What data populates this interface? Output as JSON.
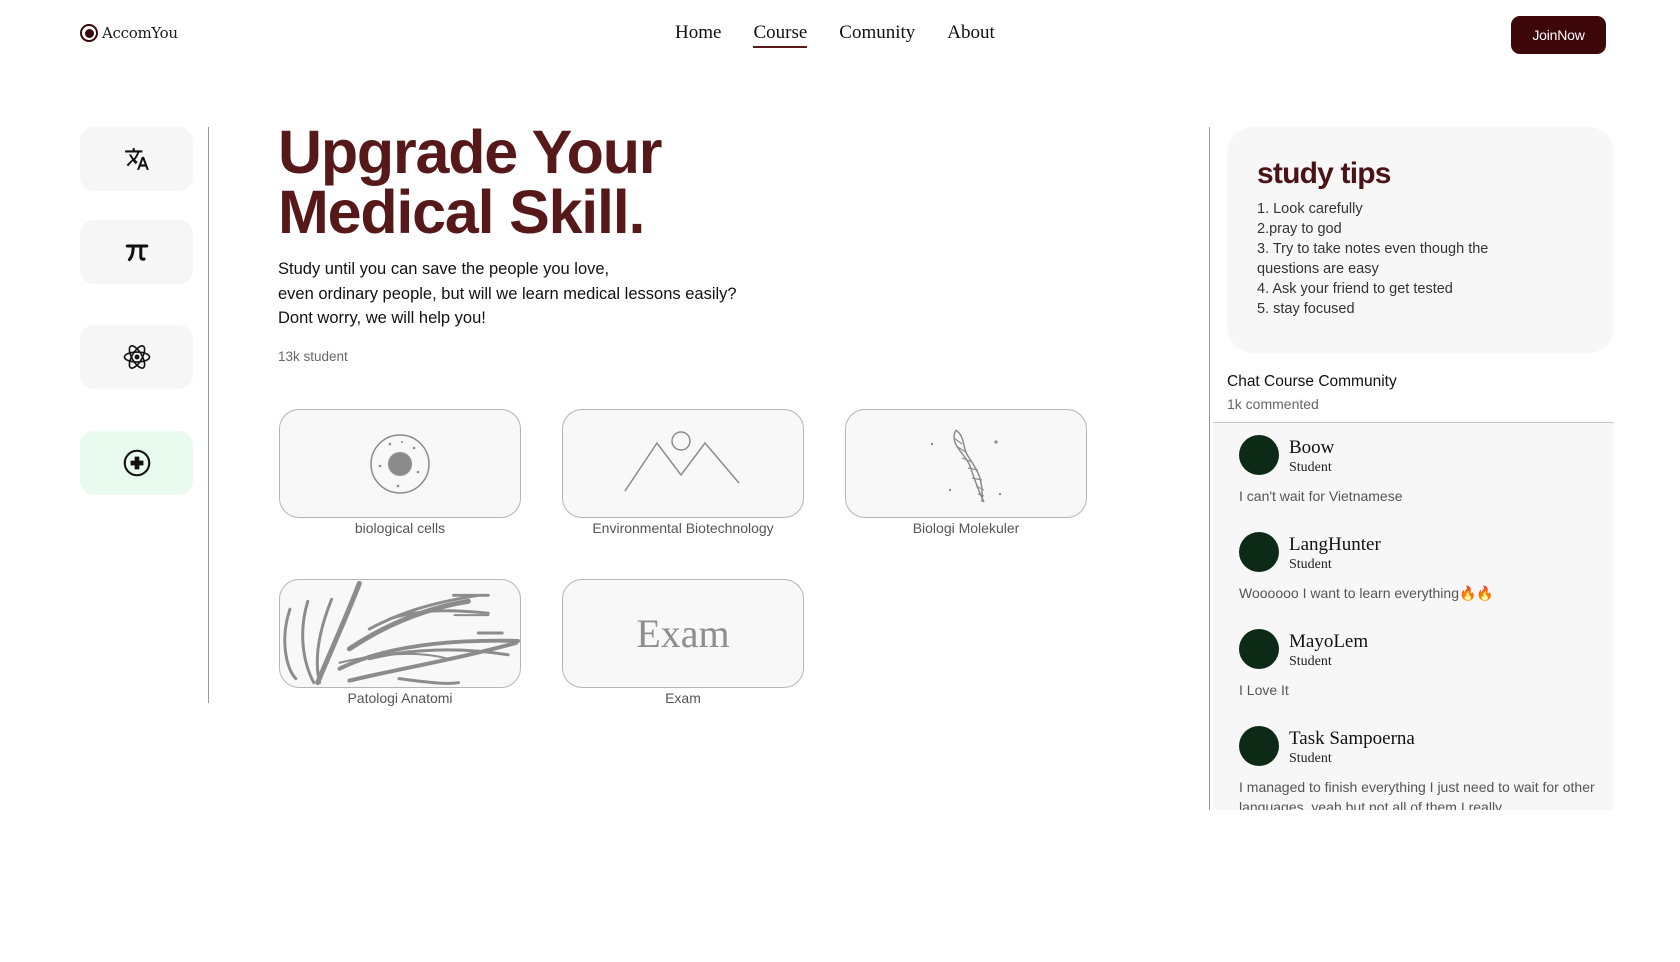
{
  "brand": {
    "name": "AccomYou"
  },
  "nav": {
    "items": [
      {
        "label": "Home",
        "active": false
      },
      {
        "label": "Course",
        "active": true
      },
      {
        "label": "Comunity",
        "active": false
      },
      {
        "label": "About",
        "active": false
      }
    ],
    "cta_label": "JoinNow"
  },
  "sidebar": {
    "items": [
      {
        "icon": "translate-icon",
        "active": false
      },
      {
        "icon": "pi-icon",
        "active": false
      },
      {
        "icon": "atom-icon",
        "active": false
      },
      {
        "icon": "medical-cross-icon",
        "active": true
      }
    ]
  },
  "hero": {
    "title_line1": "Upgrade Your",
    "title_line2": "Medical Skill.",
    "desc_line1": "Study until you can save the people you love,",
    "desc_line2": "even ordinary people, but will we learn medical lessons easily?",
    "desc_line3": "Dont worry, we will help you!",
    "student_count": "13k student"
  },
  "courses": [
    {
      "label": "biological cells",
      "icon": "cell-icon"
    },
    {
      "label": "Environmental Biotechnology",
      "icon": "mountain-icon"
    },
    {
      "label": "Biologi Molekuler",
      "icon": "dna-icon"
    },
    {
      "label": "Patologi Anatomi",
      "icon": "tissue-sketch-icon"
    },
    {
      "label": "Exam",
      "icon_text": "Exam"
    }
  ],
  "study_tips": {
    "title": "study tips",
    "items": [
      "1. Look carefully",
      "2.pray to god",
      "3. Try to take notes even though the questions are easy",
      "4. Ask your friend to get tested",
      "5. stay focused"
    ]
  },
  "chat": {
    "title": "Chat Course Community",
    "subtitle": "1k commented",
    "comments": [
      {
        "name": "Boow",
        "role": "Student",
        "text": "I can't wait for Vietnamese"
      },
      {
        "name": "LangHunter",
        "role": "Student",
        "text": "Woooooo I want to learn everything🔥🔥"
      },
      {
        "name": "MayoLem",
        "role": "Student",
        "text": "I Love It"
      },
      {
        "name": "Task Sampoerna",
        "role": "Student",
        "text": "I managed to finish everything I just need to wait for other languages, yeah but not all of them I really"
      }
    ]
  },
  "colors": {
    "brand": "#561818",
    "cta": "#3d0608",
    "avatar": "#0d2a17",
    "active_side": "#e8fbee"
  }
}
